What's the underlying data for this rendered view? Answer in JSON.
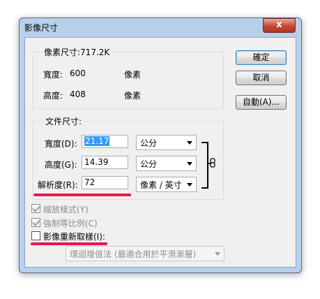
{
  "window": {
    "title": "影像尺寸",
    "close_label": "x"
  },
  "pixel_dimensions": {
    "legend": "像素尺寸:717.2K",
    "width_label": "寬度:",
    "width_value": "600",
    "width_unit": "像素",
    "height_label": "高度:",
    "height_value": "408",
    "height_unit": "像素"
  },
  "document_size": {
    "legend": "文件尺寸:",
    "width_label": "寬度(D):",
    "width_value": "21.17",
    "width_unit": "公分",
    "height_label": "高度(G):",
    "height_value": "14.39",
    "height_unit": "公分",
    "resolution_label": "解析度(R):",
    "resolution_value": "72",
    "resolution_unit": "像素 / 英寸"
  },
  "options": {
    "scale_styles": {
      "label": "縮放樣式(Y)",
      "checked": true,
      "enabled": false
    },
    "constrain_proportions": {
      "label": "強制等比例(C)",
      "checked": true,
      "enabled": false
    },
    "resample_image": {
      "label": "影像重新取樣(I):",
      "checked": false,
      "enabled": true
    },
    "resample_method": "環迴增值法 (最適合用於平滑漸層)"
  },
  "buttons": {
    "ok": "確定",
    "cancel": "取消",
    "auto": "自動(A)..."
  },
  "colors": {
    "annotation_underline": "#e8174c",
    "frame": "#b8d0ea",
    "selection": "#3399ff"
  },
  "icons": {
    "close": "close-icon",
    "link": "chain-link-icon"
  }
}
